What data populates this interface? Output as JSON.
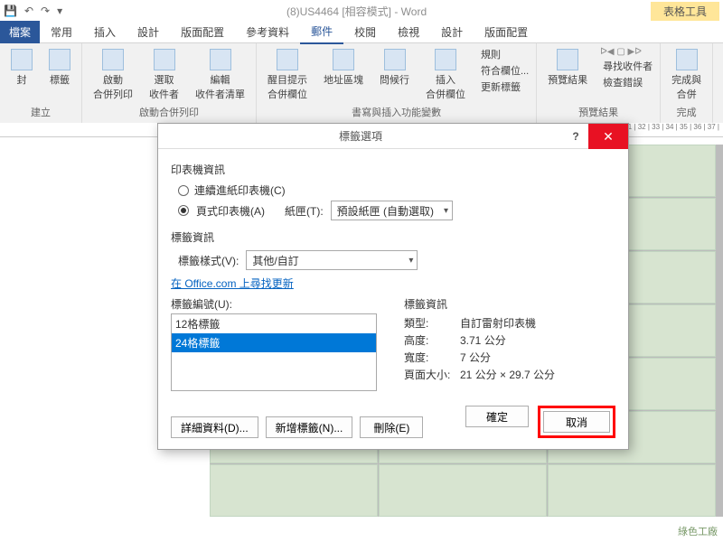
{
  "title_bar": {
    "qat_icons": [
      "save-icon",
      "undo-icon",
      "redo-icon",
      "down-icon"
    ],
    "doc_title": "(8)US4464 [相容模式] - Word",
    "context_tab": "表格工具"
  },
  "tabs": {
    "file": "檔案",
    "items": [
      "常用",
      "插入",
      "設計",
      "版面配置",
      "參考資料",
      "郵件",
      "校閱",
      "檢視",
      "設計",
      "版面配置"
    ],
    "active_index": 5
  },
  "ribbon": {
    "g1": {
      "btn1": "封",
      "btn2": "標籤",
      "label": "建立"
    },
    "g2": {
      "btn1": "啟動\n合併列印",
      "btn2": "選取\n收件者",
      "btn3": "編輯\n收件者清單",
      "label": "啟動合併列印"
    },
    "g3": {
      "btn1": "醒目提示\n合併欄位",
      "btn2": "地址區塊",
      "btn3": "問候行",
      "btn4": "插入\n合併欄位",
      "s1": "規則",
      "s2": "符合欄位...",
      "s3": "更新標籤",
      "label": "書寫與插入功能變數"
    },
    "g4": {
      "btn1": "預覽結果",
      "s1": "尋找收件者",
      "s2": "檢查錯誤",
      "label": "預覽結果"
    },
    "g5": {
      "btn1": "完成與\n合併",
      "label": "完成"
    }
  },
  "ruler_marks": "| 31 | 32 | 33 | 34 | 35 | 36 | 37 |",
  "dialog": {
    "title": "標籤選項",
    "printer_section": "印表機資訊",
    "radio_continuous": "連續進紙印表機(C)",
    "radio_page": "頁式印表機(A)",
    "tray_label": "紙匣(T):",
    "tray_value": "預設紙匣 (自動選取)",
    "label_section": "標籤資訊",
    "vendor_label": "標籤樣式(V):",
    "vendor_value": "其他/自訂",
    "office_link": "在 Office.com 上尋找更新",
    "number_label": "標籤編號(U):",
    "list": [
      "12格標籤",
      "24格標籤"
    ],
    "list_selected": 1,
    "info_title": "標籤資訊",
    "info": {
      "type_k": "類型:",
      "type_v": "自訂雷射印表機",
      "height_k": "高度:",
      "height_v": "3.71 公分",
      "width_k": "寬度:",
      "width_v": "7 公分",
      "page_k": "頁面大小:",
      "page_v": "21 公分 × 29.7 公分"
    },
    "btn_details": "詳細資料(D)...",
    "btn_new": "新增標籤(N)...",
    "btn_delete": "刪除(E)",
    "btn_ok": "確定",
    "btn_cancel": "取消"
  },
  "watermark": "綠色工廠"
}
